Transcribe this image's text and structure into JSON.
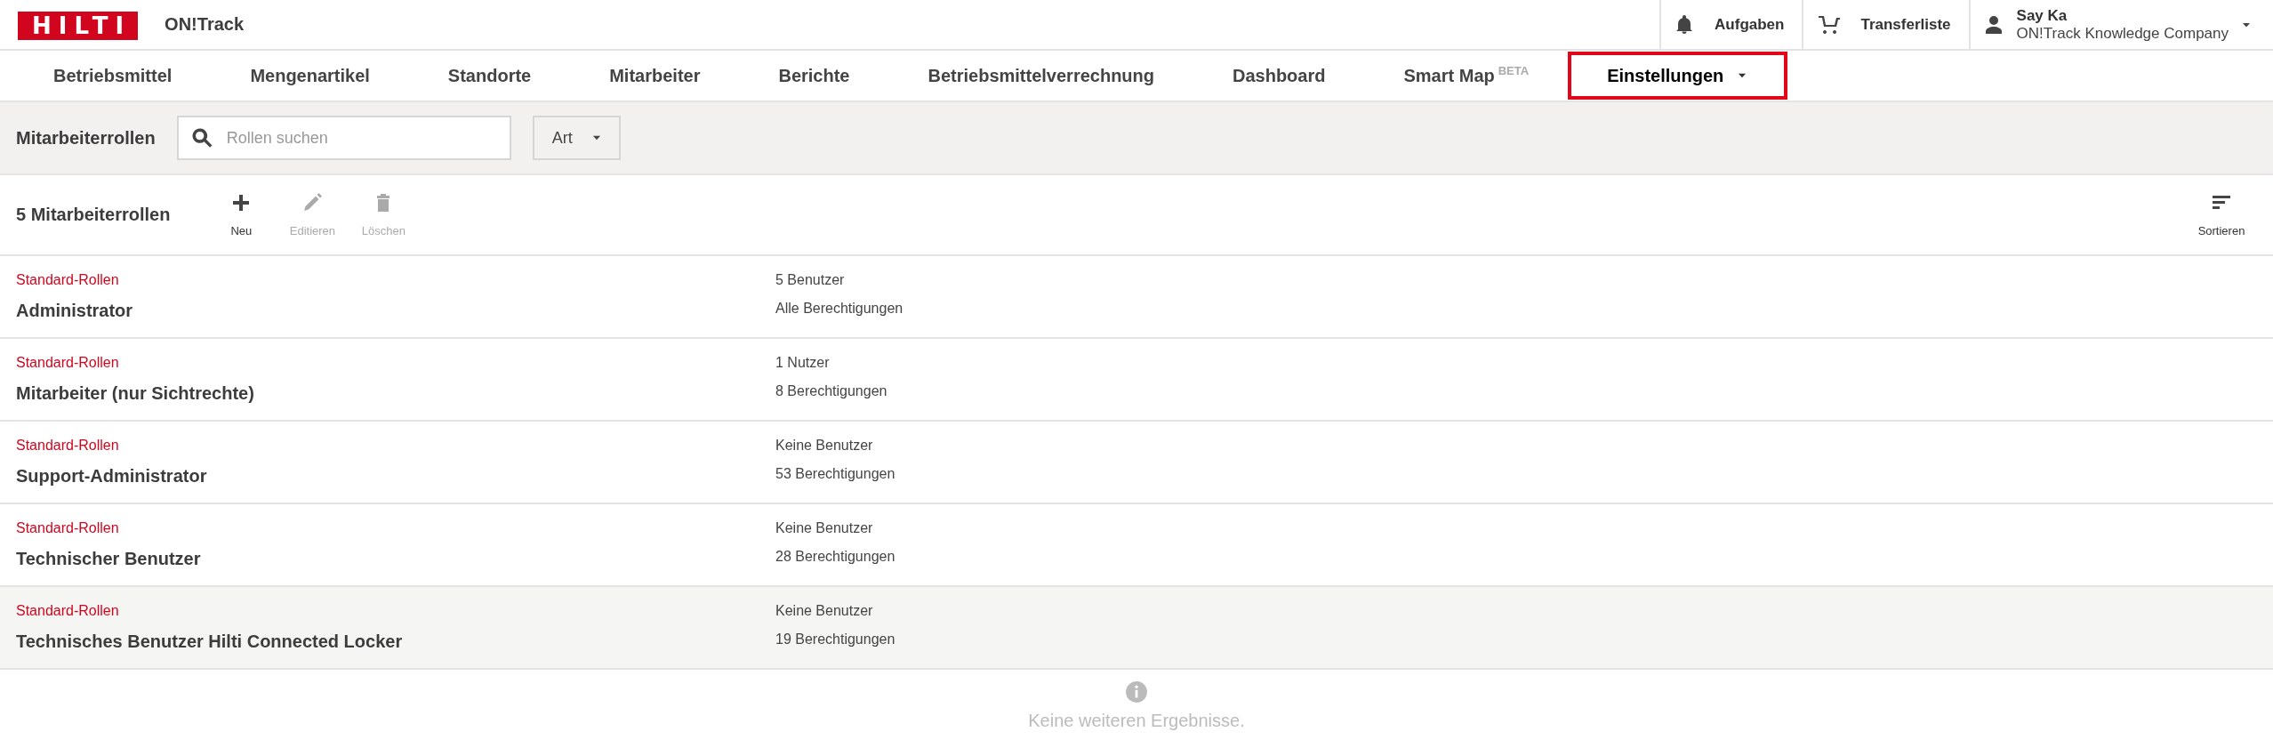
{
  "header": {
    "brand": "HILTI",
    "app_name": "ON!Track",
    "actions": [
      {
        "kind": "bell",
        "label": "Aufgaben"
      },
      {
        "kind": "cart",
        "label": "Transferliste"
      }
    ],
    "user": {
      "name": "Say Ka",
      "company": "ON!Track Knowledge Company"
    }
  },
  "nav": [
    {
      "label": "Betriebsmittel",
      "selected": false
    },
    {
      "label": "Mengenartikel",
      "selected": false
    },
    {
      "label": "Standorte",
      "selected": false
    },
    {
      "label": "Mitarbeiter",
      "selected": false
    },
    {
      "label": "Berichte",
      "selected": false
    },
    {
      "label": "Betriebsmittelverrechnung",
      "selected": false
    },
    {
      "label": "Dashboard",
      "selected": false
    },
    {
      "label": "Smart Map",
      "badge": "BETA",
      "selected": false
    },
    {
      "label": "Einstellungen",
      "dropdown": true,
      "selected": true
    }
  ],
  "filter_bar": {
    "title": "Mitarbeiterrollen",
    "search": {
      "placeholder": "Rollen suchen"
    },
    "type_filter": "Art"
  },
  "toolbar": {
    "count": "5 Mitarbeiterrollen",
    "actions": [
      {
        "kind": "plus",
        "label": "Neu",
        "disabled": false
      },
      {
        "kind": "pencil",
        "label": "Editieren",
        "disabled": true
      },
      {
        "kind": "trash",
        "label": "Löschen",
        "disabled": true
      }
    ],
    "sort": "Sortieren"
  },
  "rows": [
    {
      "category": "Standard-Rollen",
      "name": "Administrator",
      "users": "5 Benutzer",
      "permissions": "Alle Berechtigungen",
      "selected": false
    },
    {
      "category": "Standard-Rollen",
      "name": "Mitarbeiter (nur Sichtrechte)",
      "users": "1 Nutzer",
      "permissions": "8 Berechtigungen",
      "selected": false
    },
    {
      "category": "Standard-Rollen",
      "name": "Support-Administrator",
      "users": "Keine Benutzer",
      "permissions": "53 Berechtigungen",
      "selected": false
    },
    {
      "category": "Standard-Rollen",
      "name": "Technischer Benutzer",
      "users": "Keine Benutzer",
      "permissions": "28 Berechtigungen",
      "selected": false
    },
    {
      "category": "Standard-Rollen",
      "name": "Technisches Benutzer Hilti Connected Locker",
      "users": "Keine Benutzer",
      "permissions": "19 Berechtigungen",
      "selected": true
    }
  ],
  "footer_message": "Keine weiteren Ergebnisse."
}
